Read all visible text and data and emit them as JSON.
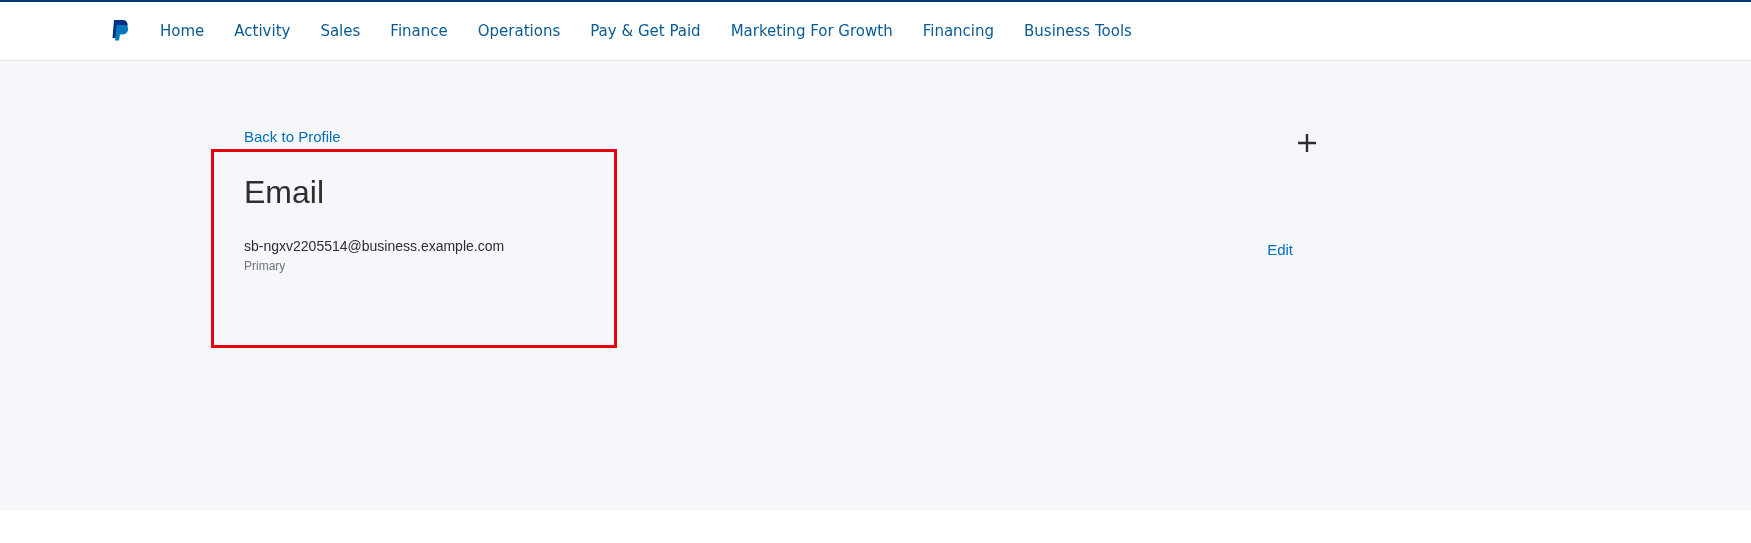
{
  "nav": {
    "items": [
      {
        "label": "Home"
      },
      {
        "label": "Activity"
      },
      {
        "label": "Sales"
      },
      {
        "label": "Finance"
      },
      {
        "label": "Operations"
      },
      {
        "label": "Pay & Get Paid"
      },
      {
        "label": "Marketing For Growth"
      },
      {
        "label": "Financing"
      },
      {
        "label": "Business Tools"
      }
    ]
  },
  "back_link": "Back to Profile",
  "email_section": {
    "title": "Email",
    "address": "sb-ngxv2205514@business.example.com",
    "label": "Primary",
    "edit": "Edit"
  }
}
